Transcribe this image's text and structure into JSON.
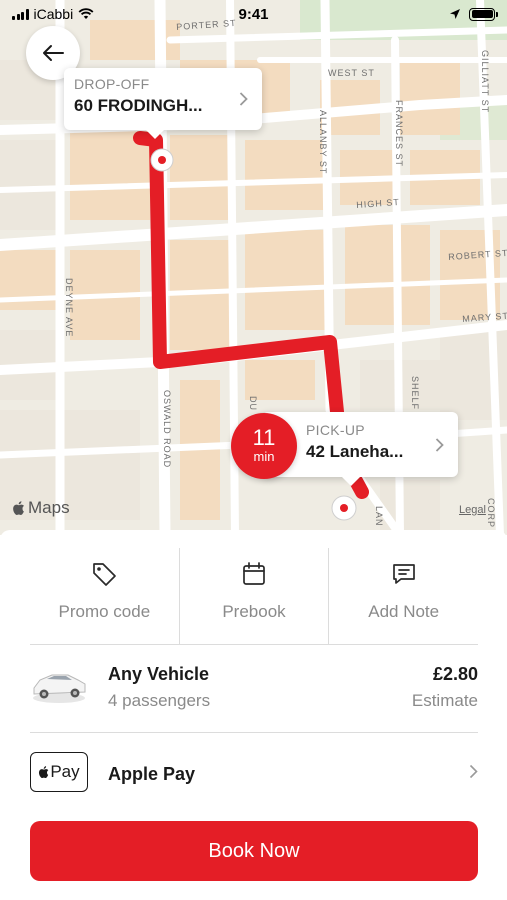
{
  "status_bar": {
    "carrier": "iCabbi",
    "time": "9:41"
  },
  "map": {
    "streets": {
      "porter": "PORTER ST",
      "west": "WEST ST",
      "gilliatt": "GILLIATT ST",
      "allanby": "ALLANBY ST",
      "frances": "FRANCES ST",
      "high": "HIGH ST",
      "robert": "ROBERT ST",
      "deyne": "DEYNE AVE",
      "mary": "MARY ST",
      "oswald": "OSWALD ROAD",
      "du": "DU",
      "shelf": "SHELF",
      "lan": "LAN",
      "corp": "CORP"
    },
    "attribution": "Maps",
    "legal": "Legal",
    "route_color": "#e41e26"
  },
  "dropoff": {
    "label": "DROP-OFF",
    "address": "60 FRODINGH..."
  },
  "pickup": {
    "label": "PICK-UP",
    "address": "42 Laneha...",
    "eta_value": "11",
    "eta_unit": "min"
  },
  "actions": [
    {
      "label": "Promo code",
      "icon": "tag-icon"
    },
    {
      "label": "Prebook",
      "icon": "calendar-icon"
    },
    {
      "label": "Add Note",
      "icon": "message-icon"
    }
  ],
  "vehicle": {
    "title": "Any Vehicle",
    "passengers": "4 passengers",
    "price": "£2.80",
    "price_note": "Estimate"
  },
  "payment": {
    "badge": "Pay",
    "method": "Apple Pay"
  },
  "book_button": "Book Now",
  "colors": {
    "accent": "#e41e26",
    "muted_text": "#8a8a8a"
  }
}
